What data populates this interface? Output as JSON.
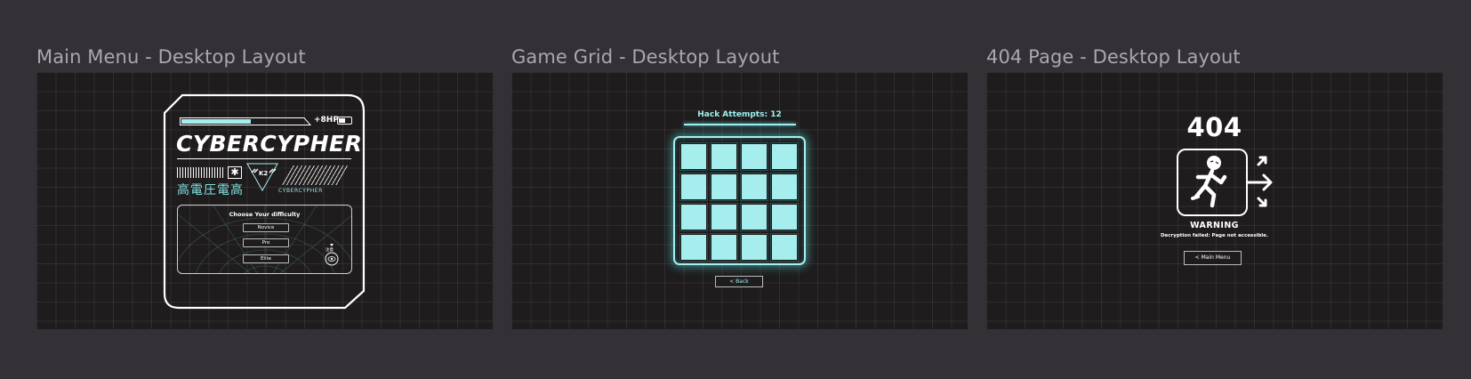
{
  "frames": [
    {
      "title": "Main Menu - Desktop Layout"
    },
    {
      "title": "Game Grid - Desktop Layout"
    },
    {
      "title": "404 Page - Desktop Layout"
    }
  ],
  "main_menu": {
    "hp_label": "+8HP",
    "logo": "CYBERCYPHER",
    "kanji": "高電圧電高",
    "k2_label": "K2",
    "designation": "CYBERCYPHER",
    "difficulty_title": "Choose Your difficulty",
    "difficulties": [
      "Novice",
      "Pro",
      "Elite"
    ],
    "eye_kanji": "注意"
  },
  "game_grid": {
    "hack_attempts": "Hack Attempts: 12",
    "back_label": "< Back",
    "tile_color": "#a6eeee"
  },
  "error_page": {
    "code": "404",
    "warning": "WARNING",
    "message": "Decryption failed: Page not accessible.",
    "main_menu_label": "< Main Menu"
  },
  "colors": {
    "canvas": "#333036",
    "frame_bg": "#1f1c1d",
    "accent_cyan": "#9ff0f0"
  }
}
